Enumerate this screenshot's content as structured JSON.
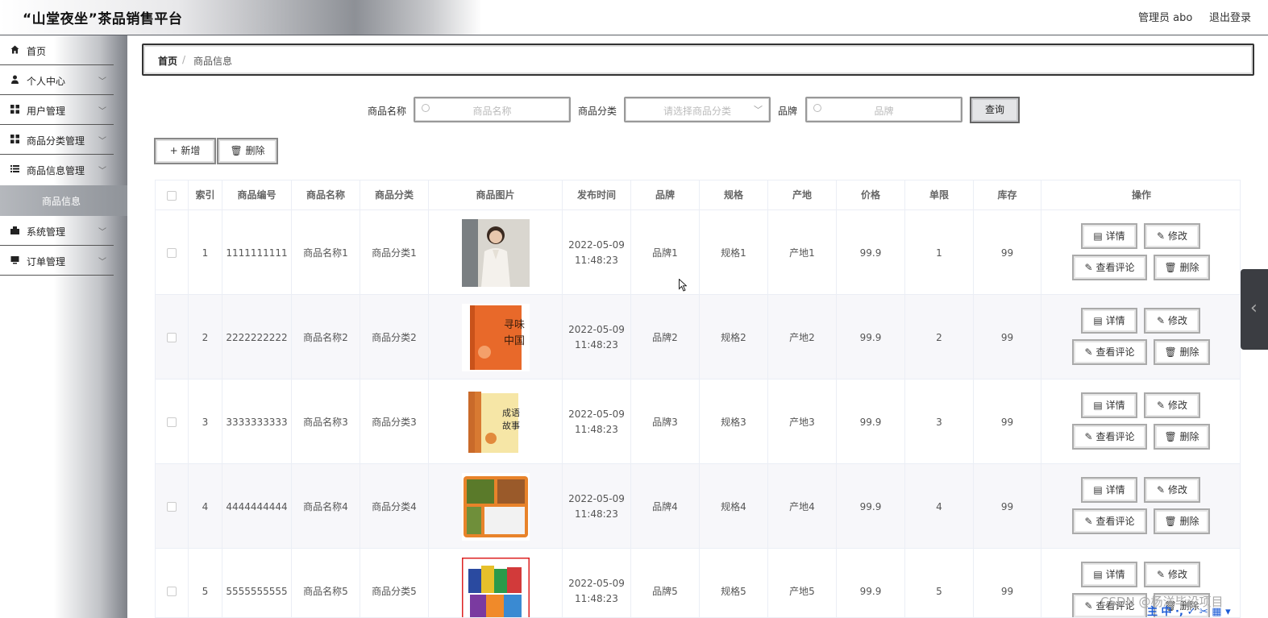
{
  "header": {
    "title": "“山堂夜坐”茶品销售平台",
    "admin": "管理员 abo",
    "logout": "退出登录"
  },
  "sidebar": {
    "items": [
      {
        "label": "首页",
        "icon": "home-icon"
      },
      {
        "label": "个人中心",
        "icon": "user-icon"
      },
      {
        "label": "用户管理",
        "icon": "grid-icon"
      },
      {
        "label": "商品分类管理",
        "icon": "grid-icon"
      },
      {
        "label": "商品信息管理",
        "icon": "list-icon"
      },
      {
        "label": "系统管理",
        "icon": "gear-icon"
      },
      {
        "label": "订单管理",
        "icon": "monitor-icon"
      }
    ],
    "active_sub": "商品信息"
  },
  "breadcrumb": {
    "home": "首页",
    "sep": "/",
    "current": "商品信息"
  },
  "search": {
    "name_label": "商品名称",
    "name_placeholder": "商品名称",
    "category_label": "商品分类",
    "category_placeholder": "请选择商品分类",
    "brand_label": "品牌",
    "brand_placeholder": "品牌",
    "query_button": "查询"
  },
  "toolbar": {
    "add": "+ 新增",
    "delete": "删除"
  },
  "table": {
    "headers": [
      "索引",
      "商品编号",
      "商品名称",
      "商品分类",
      "商品图片",
      "发布时间",
      "品牌",
      "规格",
      "产地",
      "价格",
      "单限",
      "库存",
      "操作"
    ],
    "rows": [
      {
        "index": "1",
        "code": "1111111111",
        "name": "商品名称1",
        "category": "商品分类1",
        "date": "2022-05-09",
        "time": "11:48:23",
        "brand": "品牌1",
        "spec": "规格1",
        "origin": "产地1",
        "price": "99.9",
        "limit": "1",
        "stock": "99"
      },
      {
        "index": "2",
        "code": "2222222222",
        "name": "商品名称2",
        "category": "商品分类2",
        "date": "2022-05-09",
        "time": "11:48:23",
        "brand": "品牌2",
        "spec": "规格2",
        "origin": "产地2",
        "price": "99.9",
        "limit": "2",
        "stock": "99"
      },
      {
        "index": "3",
        "code": "3333333333",
        "name": "商品名称3",
        "category": "商品分类3",
        "date": "2022-05-09",
        "time": "11:48:23",
        "brand": "品牌3",
        "spec": "规格3",
        "origin": "产地3",
        "price": "99.9",
        "limit": "3",
        "stock": "99"
      },
      {
        "index": "4",
        "code": "4444444444",
        "name": "商品名称4",
        "category": "商品分类4",
        "date": "2022-05-09",
        "time": "11:48:23",
        "brand": "品牌4",
        "spec": "规格4",
        "origin": "产地4",
        "price": "99.9",
        "limit": "4",
        "stock": "99"
      },
      {
        "index": "5",
        "code": "5555555555",
        "name": "商品名称5",
        "category": "商品分类5",
        "date": "2022-05-09",
        "time": "11:48:23",
        "brand": "品牌5",
        "spec": "规格5",
        "origin": "产地5",
        "price": "99.9",
        "limit": "5",
        "stock": "99"
      }
    ],
    "actions": {
      "detail": "详情",
      "edit": "修改",
      "review": "查看评论",
      "delete": "删除"
    }
  },
  "watermark": "CSDN @杨洋毕设项目",
  "ime": "主 中 ·, ✓ ✂ ▦ ▾"
}
